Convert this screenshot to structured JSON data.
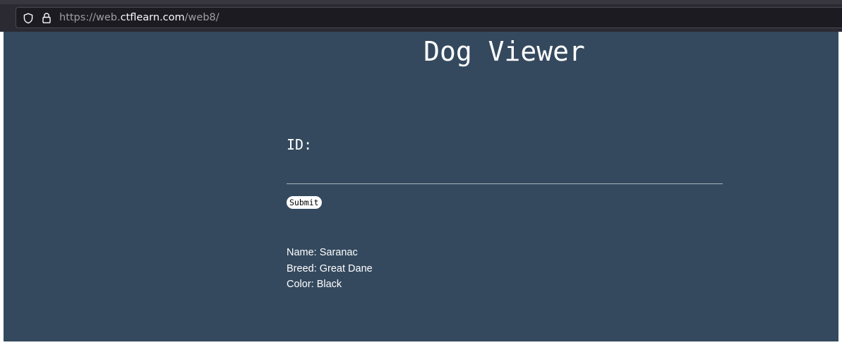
{
  "browser": {
    "url_prefix": "https://web.",
    "url_domain": "ctflearn.com",
    "url_path": "/web8/"
  },
  "page": {
    "title": "Dog Viewer",
    "id_label": "ID:",
    "id_value": "",
    "submit_label": "Submit",
    "dog": {
      "name_line": "Name: Saranac",
      "breed_line": "Breed: Great Dane",
      "color_line": "Color: Black"
    }
  },
  "colors": {
    "page_background": "#34495e",
    "browser_toolbar": "#2b2a33",
    "url_field": "#1c1b22"
  },
  "icons": [
    "shield-icon",
    "lock-icon"
  ]
}
